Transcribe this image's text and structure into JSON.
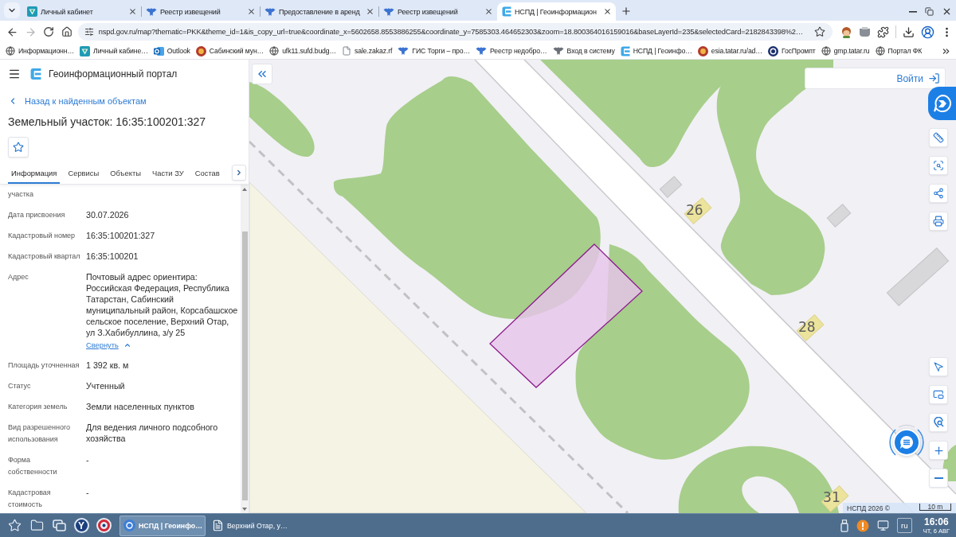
{
  "browser": {
    "tabs": [
      {
        "title": "Личный кабинет",
        "kind": "shield",
        "selected": false
      },
      {
        "title": "Реестр извещений",
        "kind": "emblem",
        "selected": false
      },
      {
        "title": "Предоставление в аренд",
        "kind": "emblem",
        "selected": false
      },
      {
        "title": "Реестр извещений",
        "kind": "emblem",
        "selected": false
      },
      {
        "title": "НСПД | Геоинформацион",
        "kind": "portal",
        "selected": true
      }
    ],
    "forward_disabled": true,
    "url": "nspd.gov.ru/map?thematic=PKK&theme_id=1&is_copy_url=true&coordinate_x=5602658.8553886255&coordinate_y=7585303.464652303&zoom=18.800364016159016&baseLayerId=235&selectedCard=2182843398%2…",
    "bookmarks": [
      {
        "label": "Информационн…",
        "kind": "globe"
      },
      {
        "label": "Личный кабине…",
        "kind": "shield"
      },
      {
        "label": "Outlook",
        "kind": "mail"
      },
      {
        "label": "Сабинский мун…",
        "kind": "crest"
      },
      {
        "label": "ufk11.sufd.budg…",
        "kind": "globe"
      },
      {
        "label": "sale.zakaz.rf",
        "kind": "file"
      },
      {
        "label": "ГИС Торги – про…",
        "kind": "emblem"
      },
      {
        "label": "Реестр недобро…",
        "kind": "emblem"
      },
      {
        "label": "Вход в систему",
        "kind": "eagle"
      },
      {
        "label": "НСПД | Геоинфо…",
        "kind": "portal"
      },
      {
        "label": "esia.tatar.ru/ad…",
        "kind": "crest"
      },
      {
        "label": "ГосПромпт",
        "kind": "badge"
      },
      {
        "label": "gmp.tatar.ru",
        "kind": "globe"
      },
      {
        "label": "Портал ФК",
        "kind": "globe"
      }
    ]
  },
  "panel": {
    "app_title": "Геоинформационный портал",
    "back_link": "Назад к найденным объектам",
    "title": "Земельный участок: 16:35:100201:327",
    "tabs": [
      {
        "label": "Информация",
        "selected": true
      },
      {
        "label": "Сервисы",
        "selected": false
      },
      {
        "label": "Объекты",
        "selected": false
      },
      {
        "label": "Части ЗУ",
        "selected": false
      },
      {
        "label": "Состав",
        "selected": false
      }
    ],
    "fields": [
      {
        "label": "участка"
      },
      {
        "label": "Дата присвоения",
        "value": "30.07.2026"
      },
      {
        "label": "Кадастровый номер",
        "value": "16:35:100201:327"
      },
      {
        "label": "Кадастровый квартал",
        "value": "16:35:100201"
      },
      {
        "label": "Адрес",
        "value": "Почтовый адрес ориентира: Российская Федерация, Республика Татарстан, Сабинский муниципальный район, Корсабашское сельское поселение, Верхний Отар, ул З.Хабибуллина, з/у 25",
        "toggle": {
          "label": "Свернуть",
          "expanded": true
        }
      },
      {
        "label": "Площадь уточненная",
        "value": "1 392 кв. м"
      },
      {
        "label": "Статус",
        "value": "Учтенный"
      },
      {
        "label": "Категория земель",
        "value": "Земли населенных пунктов"
      },
      {
        "label": "Вид разрешенного использования",
        "value": "Для ведения личного подсобного хозяйства"
      },
      {
        "label": "Форма собственности",
        "value": "-"
      },
      {
        "label": "Кадастровая стоимость",
        "value": "-"
      }
    ]
  },
  "map": {
    "login": "Войти",
    "house_numbers": [
      {
        "label": "26"
      },
      {
        "label": "28"
      },
      {
        "label": "31"
      }
    ],
    "attribution": "НСПД 2026 ©",
    "scale": "10 m"
  },
  "taskbar": {
    "launchers": [
      {
        "kind": "favorites"
      },
      {
        "kind": "files"
      },
      {
        "kind": "windows"
      },
      {
        "kind": "letter",
        "letter": "Y"
      },
      {
        "kind": "ring"
      }
    ],
    "tasks": [
      {
        "label": "НСПД | Геоинфо…",
        "kind": "browser",
        "selected": true
      },
      {
        "label": "Верхний Отар, у…",
        "kind": "document",
        "selected": false
      }
    ],
    "language": "ru",
    "time": "16:06",
    "date": "ЧТ, 6 АВГ"
  }
}
